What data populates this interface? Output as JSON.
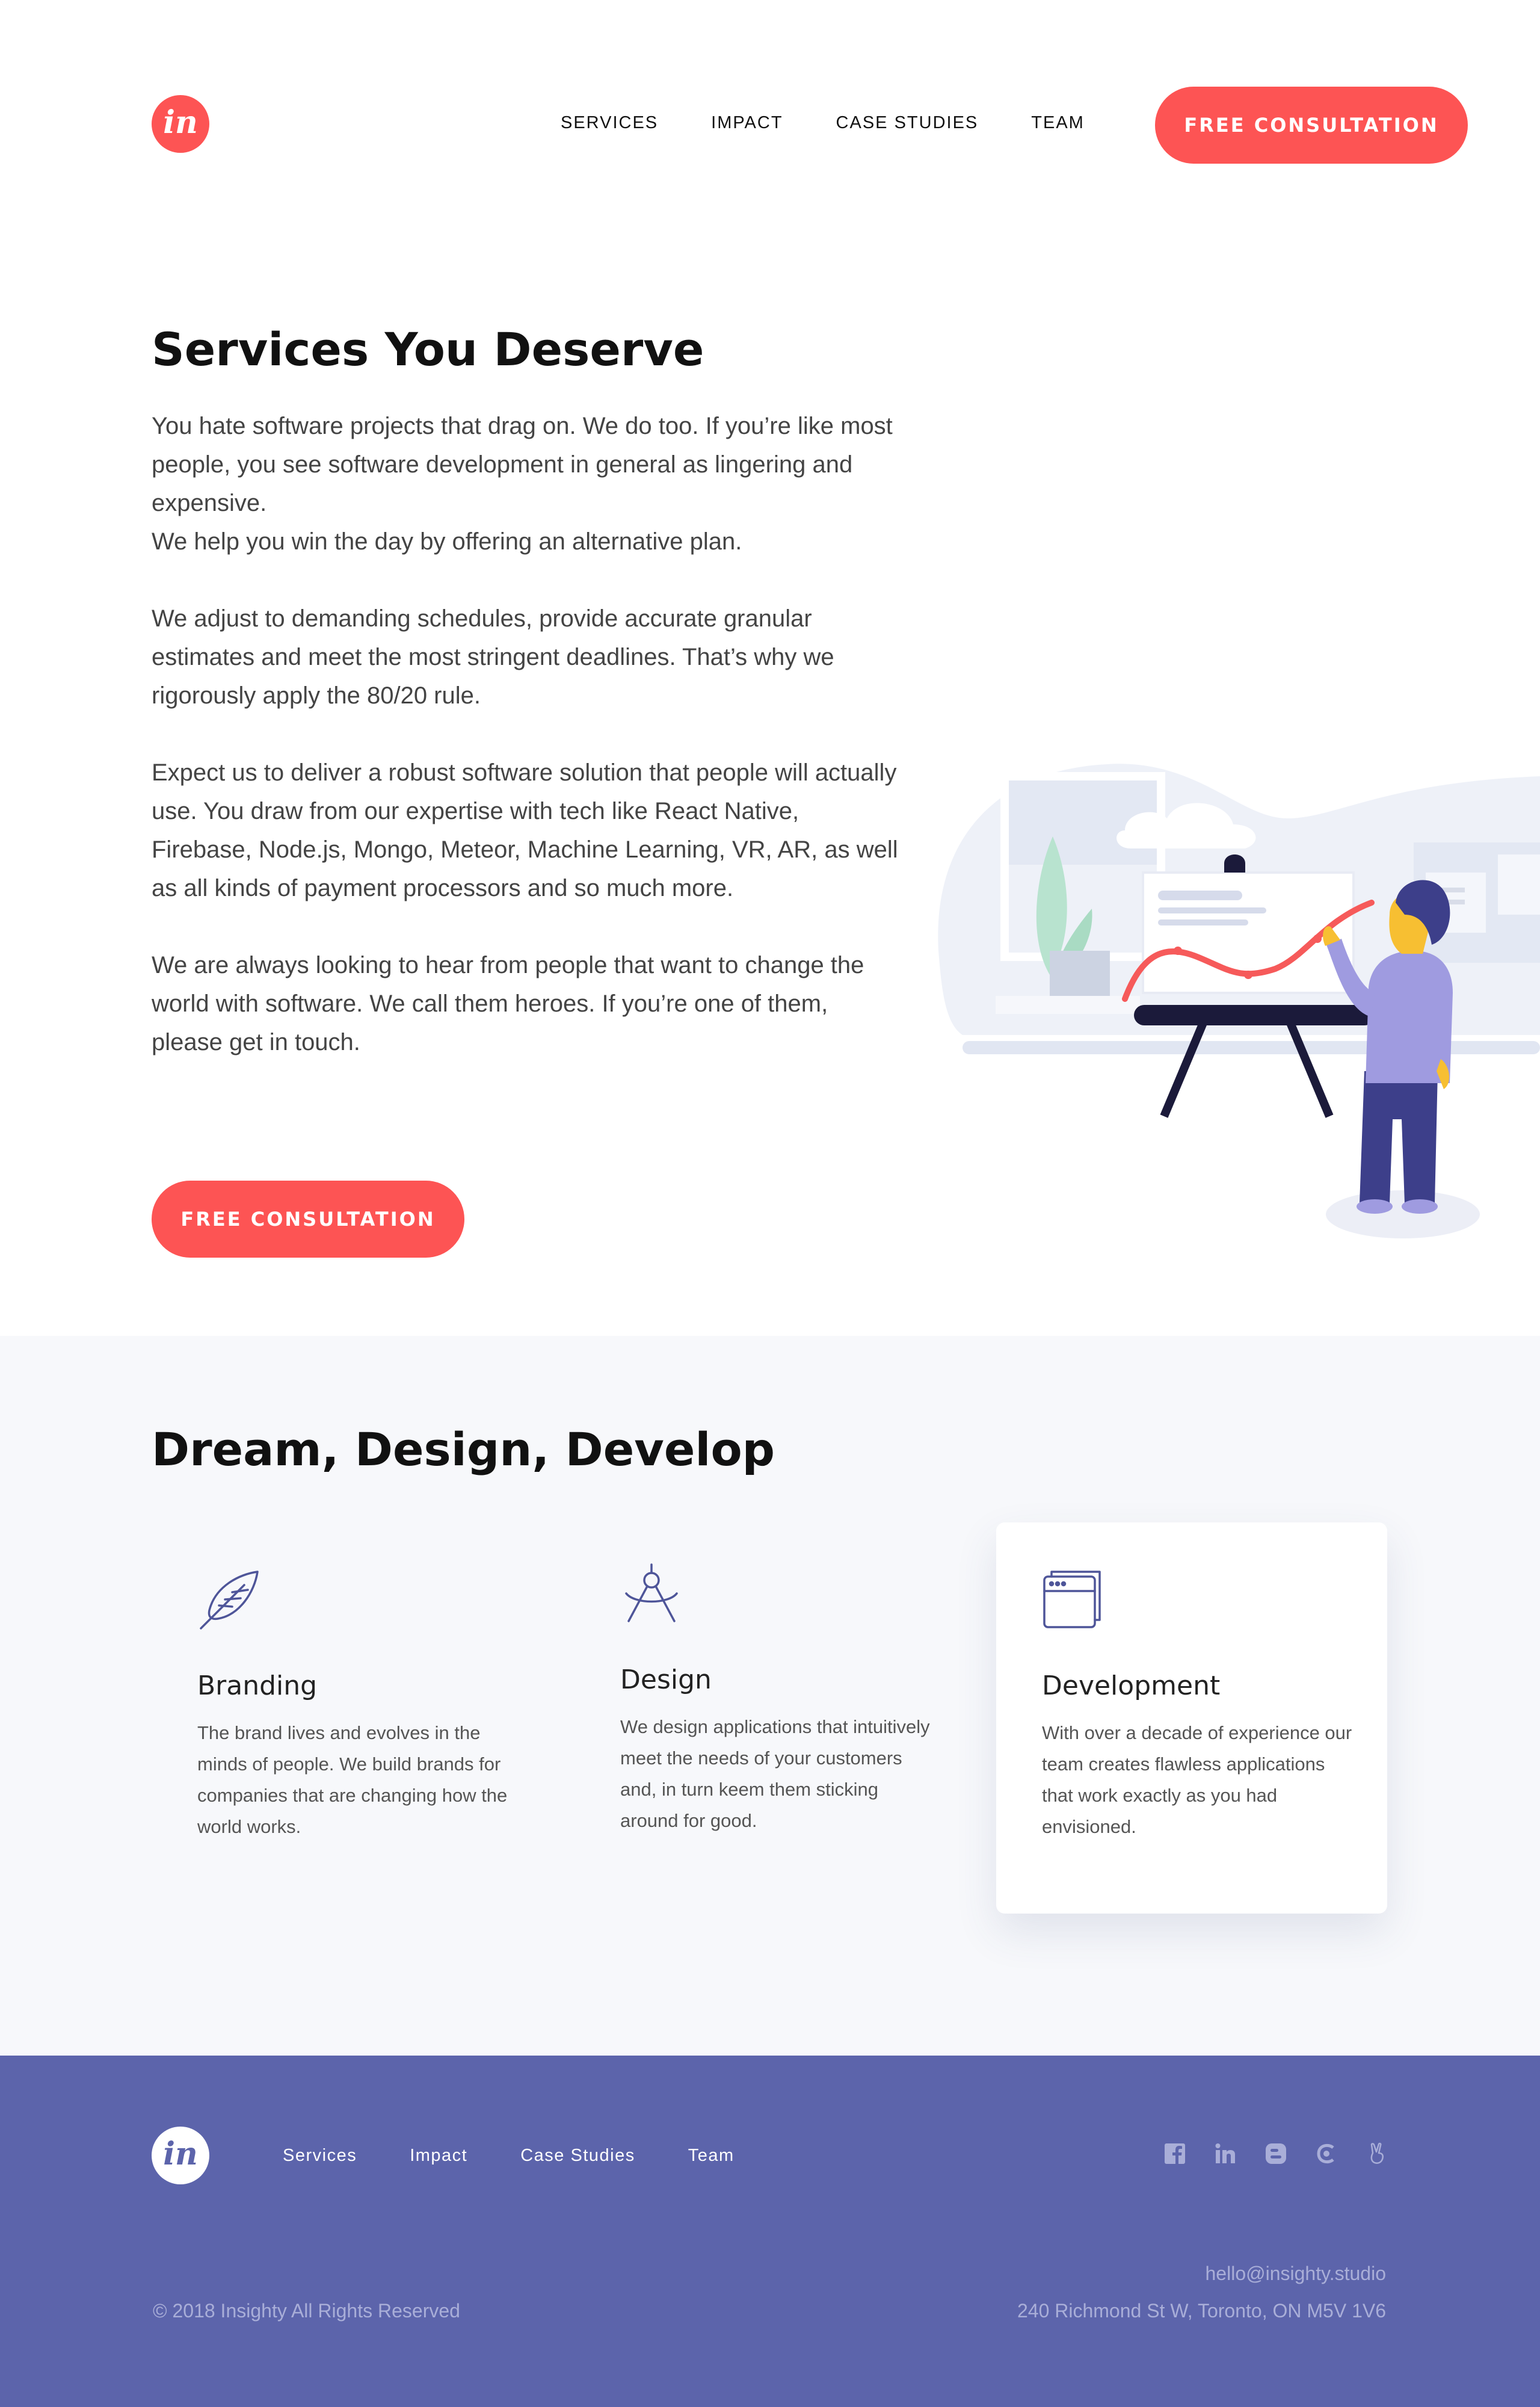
{
  "header": {
    "logo_text": "in",
    "nav": [
      "SERVICES",
      "IMPACT",
      "CASE STUDIES",
      "TEAM"
    ],
    "cta_label": "FREE CONSULTATION"
  },
  "hero": {
    "title": "Services You Deserve",
    "paragraphs": [
      "You hate software projects that drag on. We do too. If you’re like most people, you see software development in general as lingering and expensive.\nWe help you win the day by offering an alternative plan.",
      "We adjust to demanding schedules, provide accurate granular estimates and meet the most stringent deadlines. That’s why we rigorously apply the 80/20 rule.",
      "Expect us to deliver a robust software solution that people will actually use. You draw from our expertise with tech like React Native, Firebase, Node.js, Mongo, Meteor, Machine Learning, VR, AR, as well as all kinds of payment processors and so much more.",
      "We are always looking to hear from people that want to change the world with software. We call them heroes. If you’re one of them, please get in touch."
    ],
    "cta_label": "FREE CONSULTATION",
    "illustration_icon": "presenter-chart-illustration"
  },
  "services": {
    "title": "Dream, Design, Develop",
    "cards": [
      {
        "icon": "feather-icon",
        "title": "Branding",
        "text": "The brand lives and evolves in the minds of people. We build brands for companies that are changing how the world works."
      },
      {
        "icon": "compass-icon",
        "title": "Design",
        "text": "We design applications that intuitively meet the needs of your customers and, in turn keem them sticking around for good."
      },
      {
        "icon": "browser-window-icon",
        "title": "Development",
        "text": "With over a decade of experience our team creates flawless applications that work exactly as you had envisioned."
      }
    ]
  },
  "footer": {
    "logo_text": "in",
    "nav": [
      "Services",
      "Impact",
      "Case Studies",
      "Team"
    ],
    "social": [
      "facebook-icon",
      "linkedin-icon",
      "blogger-icon",
      "clutch-icon",
      "angellist-icon"
    ],
    "email": "hello@insighty.studio",
    "address": "240 Richmond St W, Toronto, ON M5V 1V6",
    "copyright": "© 2018 Insighty All Rights Reserved"
  },
  "colors": {
    "accent": "#fd5454",
    "footer_bg": "#5c64ab",
    "section_bg": "#f7f8fb",
    "icon_stroke": "#4e5599"
  }
}
